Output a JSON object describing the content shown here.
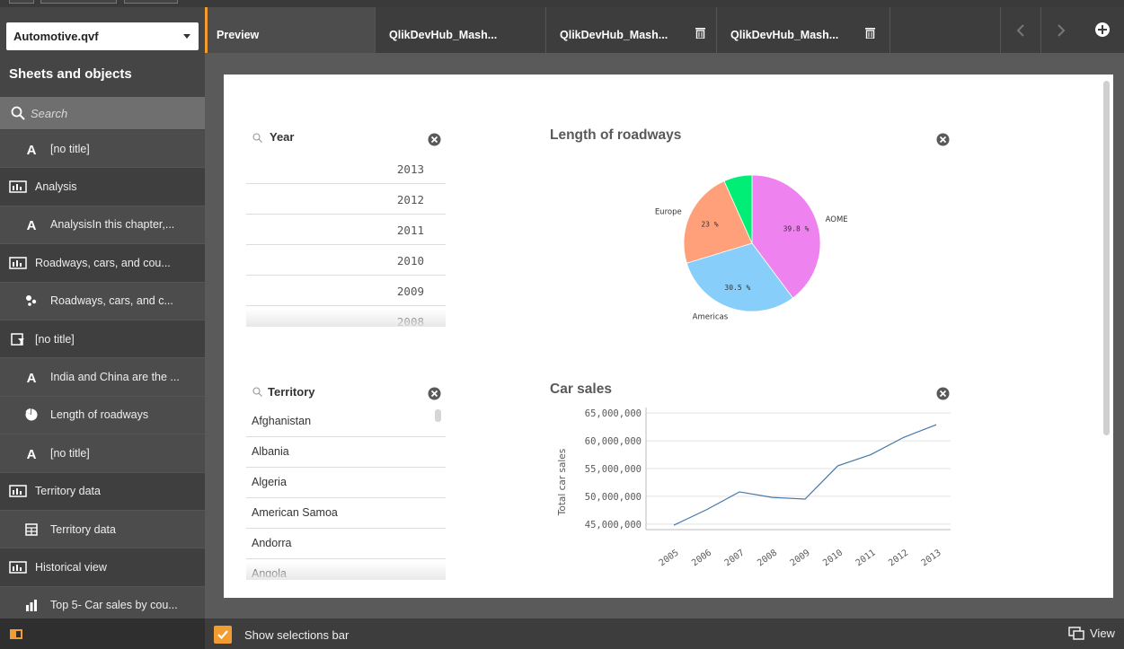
{
  "app_select": {
    "value": "Automotive.qvf"
  },
  "sidebar": {
    "title": "Sheets and objects",
    "search_placeholder": "Search",
    "items": [
      {
        "label": "[no title]",
        "icon": "text-icon",
        "level": "child"
      },
      {
        "label": "Analysis",
        "icon": "sheet-icon",
        "level": "sheet"
      },
      {
        "label": "AnalysisIn this chapter,...",
        "icon": "text-icon",
        "level": "child"
      },
      {
        "label": "Roadways, cars, and cou...",
        "icon": "sheet-icon",
        "level": "sheet"
      },
      {
        "label": "Roadways, cars, and c...",
        "icon": "scatter-icon",
        "level": "child"
      },
      {
        "label": "[no title]",
        "icon": "filter-pane-icon",
        "level": "sheet"
      },
      {
        "label": "India and China are the ...",
        "icon": "text-icon",
        "level": "child"
      },
      {
        "label": "Length of roadways",
        "icon": "pie-icon",
        "level": "child"
      },
      {
        "label": "[no title]",
        "icon": "text-icon",
        "level": "child"
      },
      {
        "label": "Territory data",
        "icon": "sheet-icon",
        "level": "sheet"
      },
      {
        "label": "Territory data",
        "icon": "table-icon",
        "level": "child"
      },
      {
        "label": "Historical view",
        "icon": "sheet-icon",
        "level": "sheet"
      },
      {
        "label": "Top 5- Car sales by cou...",
        "icon": "bar-icon",
        "level": "child"
      }
    ]
  },
  "tabs": [
    {
      "label": "Preview",
      "active": true,
      "trash": false
    },
    {
      "label": "QlikDevHub_Mash...",
      "active": false,
      "trash": false
    },
    {
      "label": "QlikDevHub_Mash...",
      "active": false,
      "trash": true
    },
    {
      "label": "QlikDevHub_Mash...",
      "active": false,
      "trash": true
    }
  ],
  "year_filter": {
    "title": "Year",
    "values": [
      "2013",
      "2012",
      "2011",
      "2010",
      "2009",
      "2008"
    ]
  },
  "territory_filter": {
    "title": "Territory",
    "values": [
      "Afghanistan",
      "Albania",
      "Algeria",
      "American Samoa",
      "Andorra",
      "Angola"
    ]
  },
  "chart_data": [
    {
      "type": "pie",
      "title": "Length of roadways",
      "slices": [
        {
          "name": "AOME",
          "value": 39.8,
          "label": "39.8 %",
          "color": "#ee82ee"
        },
        {
          "name": "Americas",
          "value": 30.5,
          "label": "30.5 %",
          "color": "#87cefa"
        },
        {
          "name": "Europe",
          "value": 23,
          "label": "23 %",
          "color": "#ffa07a"
        },
        {
          "name": "",
          "value": 6.7,
          "label": "",
          "color": "#00ee76"
        }
      ]
    },
    {
      "type": "line",
      "title": "Car sales",
      "ylabel": "Total car sales",
      "xlabel": "",
      "ylim": [
        44000000,
        66000000
      ],
      "yticks": [
        45000000,
        50000000,
        55000000,
        60000000,
        65000000
      ],
      "ytick_labels": [
        "45,000,000",
        "50,000,000",
        "55,000,000",
        "60,000,000",
        "65,000,000"
      ],
      "x": [
        "2005",
        "2006",
        "2007",
        "2008",
        "2009",
        "2010",
        "2011",
        "2012",
        "2013"
      ],
      "series": [
        {
          "values": [
            44800000,
            47600000,
            50800000,
            49800000,
            49500000,
            55500000,
            57500000,
            60600000,
            62900000
          ],
          "color": "#4477aa"
        }
      ],
      "grid": true
    }
  ],
  "bottom": {
    "show_selections_label": "Show selections bar",
    "view_label": "View"
  },
  "colors": {
    "accent": "#f29c31",
    "sidebar_bg": "#454545",
    "tabbar_bg": "#3d3d3d"
  }
}
